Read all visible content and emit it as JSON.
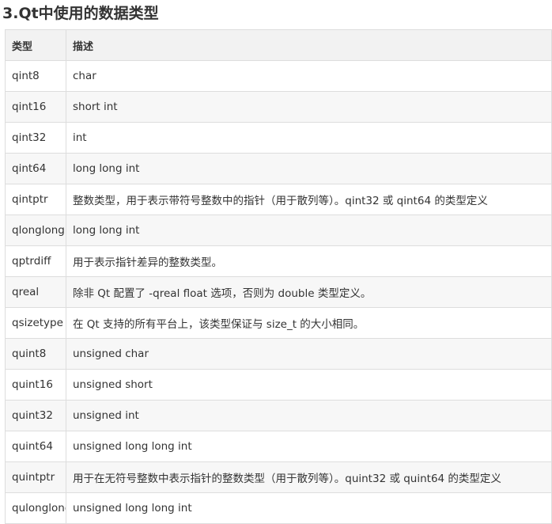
{
  "heading": "3.Qt中使用的数据类型",
  "table": {
    "headers": [
      "类型",
      "描述"
    ],
    "rows": [
      {
        "type": "qint8",
        "desc": "char"
      },
      {
        "type": "qint16",
        "desc": "short int"
      },
      {
        "type": "qint32",
        "desc": "int"
      },
      {
        "type": "qint64",
        "desc": "long long int"
      },
      {
        "type": "qintptr",
        "desc": "整数类型，用于表示带符号整数中的指针（用于散列等）。qint32 或 qint64 的类型定义"
      },
      {
        "type": "qlonglong",
        "desc": "long long int"
      },
      {
        "type": "qptrdiff",
        "desc": "用于表示指针差异的整数类型。"
      },
      {
        "type": "qreal",
        "desc": "除非 Qt 配置了 -qreal float 选项，否则为 double 类型定义。"
      },
      {
        "type": "qsizetype",
        "desc": "在 Qt 支持的所有平台上，该类型保证与 size_t 的大小相同。"
      },
      {
        "type": "quint8",
        "desc": "unsigned char"
      },
      {
        "type": "quint16",
        "desc": "unsigned short"
      },
      {
        "type": "quint32",
        "desc": "unsigned int"
      },
      {
        "type": "quint64",
        "desc": "unsigned long long int"
      },
      {
        "type": "quintptr",
        "desc": "用于在无符号整数中表示指针的整数类型（用于散列等）。quint32 或 quint64 的类型定义"
      },
      {
        "type": "qulonglong",
        "desc": "unsigned long long int"
      }
    ]
  }
}
